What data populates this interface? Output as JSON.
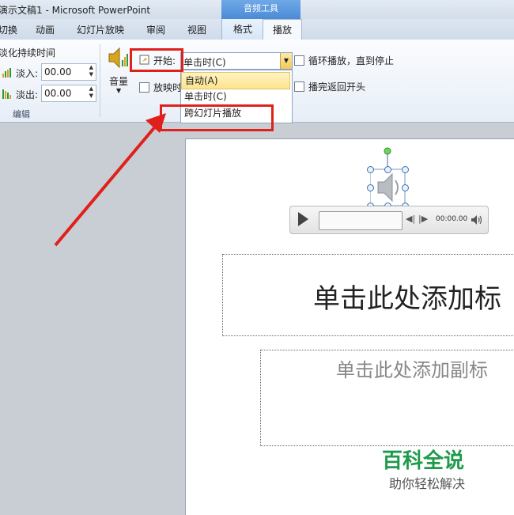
{
  "window": {
    "title": "演示文稿1 - Microsoft PowerPoint",
    "context_group": "音频工具"
  },
  "tabs": [
    "切换",
    "动画",
    "幻灯片放映",
    "审阅",
    "视图",
    "格式",
    "播放"
  ],
  "ribbon": {
    "fade_label": "淡化持续时间",
    "fade_in_label": "淡入:",
    "fade_in_value": "00.00",
    "fade_out_label": "淡出:",
    "fade_out_value": "00.00",
    "edit_group": "编辑",
    "volume_label": "音量",
    "start_label": "开始:",
    "start_value": "单击时(C)",
    "hide_label": "放映时",
    "loop_label": "循环播放，直到停止",
    "rewind_label": "播完返回开头",
    "dropdown_options": [
      "自动(A)",
      "单击时(C)",
      "跨幻灯片播放"
    ]
  },
  "player": {
    "time": "00:00.00"
  },
  "slide": {
    "title_placeholder": "单击此处添加标",
    "subtitle_placeholder": "单击此处添加副标"
  },
  "watermark": {
    "line1": "百科全说",
    "line2": "助你轻松解决"
  },
  "colors": {
    "annotation_red": "#e0201b",
    "accent_blue": "#4b8bd6"
  }
}
